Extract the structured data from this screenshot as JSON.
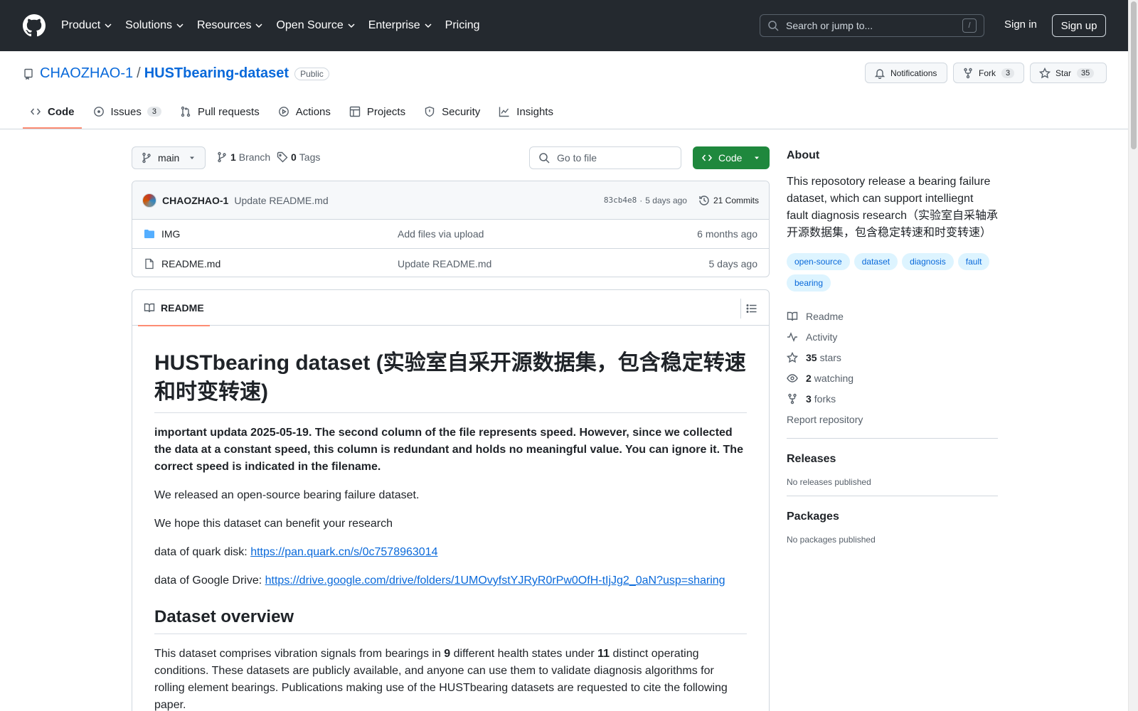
{
  "header": {
    "nav": [
      "Product",
      "Solutions",
      "Resources",
      "Open Source",
      "Enterprise",
      "Pricing"
    ],
    "search_placeholder": "Search or jump to...",
    "search_shortcut": "/",
    "signin": "Sign in",
    "signup": "Sign up"
  },
  "repo": {
    "owner": "CHAOZHAO-1",
    "separator": "/",
    "name": "HUSTbearing-dataset",
    "visibility": "Public",
    "notifications_label": "Notifications",
    "fork_label": "Fork",
    "fork_count": "3",
    "star_label": "Star",
    "star_count": "35"
  },
  "tabs": [
    {
      "label": "Code",
      "icon": "code-icon"
    },
    {
      "label": "Issues",
      "icon": "issue-icon",
      "count": "3"
    },
    {
      "label": "Pull requests",
      "icon": "pull-request-icon"
    },
    {
      "label": "Actions",
      "icon": "play-icon"
    },
    {
      "label": "Projects",
      "icon": "table-icon"
    },
    {
      "label": "Security",
      "icon": "shield-icon"
    },
    {
      "label": "Insights",
      "icon": "graph-icon"
    }
  ],
  "toolbar": {
    "branch": "main",
    "branch_count": "1",
    "branch_label": "Branch",
    "tag_count": "0",
    "tag_label": "Tags",
    "goto_placeholder": "Go to file",
    "code_button": "Code"
  },
  "latest_commit": {
    "author": "CHAOZHAO-1",
    "message": "Update README.md",
    "hash": "83cb4e8",
    "time": "5 days ago",
    "commits": "21 Commits"
  },
  "files": [
    {
      "name": "IMG",
      "type": "folder",
      "message": "Add files via upload",
      "date": "6 months ago"
    },
    {
      "name": "README.md",
      "type": "file",
      "message": "Update README.md",
      "date": "5 days ago"
    }
  ],
  "readme": {
    "tab_label": "README",
    "title": "HUSTbearing dataset (实验室自采开源数据集，包含稳定转速和时变转速)",
    "notice": "important updata 2025-05-19. The second column of the file represents speed. However, since we collected the data at a constant speed, this column is redundant and holds no meaningful value. You can ignore it. The correct speed is indicated in the filename.",
    "p1": "We released an open-source bearing failure dataset.",
    "p2": "We hope this dataset can benefit your research",
    "quark_label": "data of quark disk: ",
    "quark_link": "https://pan.quark.cn/s/0c7578963014",
    "gdrive_label": "data of Google Drive: ",
    "gdrive_link": "https://drive.google.com/drive/folders/1UMOvyfstYJRyR0rPw0OfH-tIjJg2_0aN?usp=sharing",
    "h2": "Dataset overview",
    "overview_a": "This dataset comprises vibration signals from bearings in ",
    "overview_n1": "9",
    "overview_b": " different health states under ",
    "overview_n2": "11",
    "overview_c": " distinct operating conditions. These datasets are publicly available, and anyone can use them to validate diagnosis algorithms for rolling element bearings. Publications making use of the HUSTbearing datasets are requested to cite the following paper."
  },
  "sidebar": {
    "about_title": "About",
    "description": "This reposotory release a bearing failure dataset, which can support intelliegnt fault diagnosis research（实验室自采轴承开源数据集，包含稳定转速和时变转速）",
    "topics": [
      "open-source",
      "dataset",
      "diagnosis",
      "fault",
      "bearing"
    ],
    "readme": "Readme",
    "activity": "Activity",
    "stars_count": "35",
    "stars_label": "stars",
    "watching_count": "2",
    "watching_label": "watching",
    "forks_count": "3",
    "forks_label": "forks",
    "report": "Report repository",
    "releases_title": "Releases",
    "releases_note": "No releases published",
    "packages_title": "Packages",
    "packages_note": "No packages published"
  },
  "colors": {
    "header_bg": "#24292f",
    "accent_link": "#0969da",
    "code_button": "#1f883d",
    "tab_underline": "#fd8c73",
    "topic_bg": "#ddf4ff"
  }
}
